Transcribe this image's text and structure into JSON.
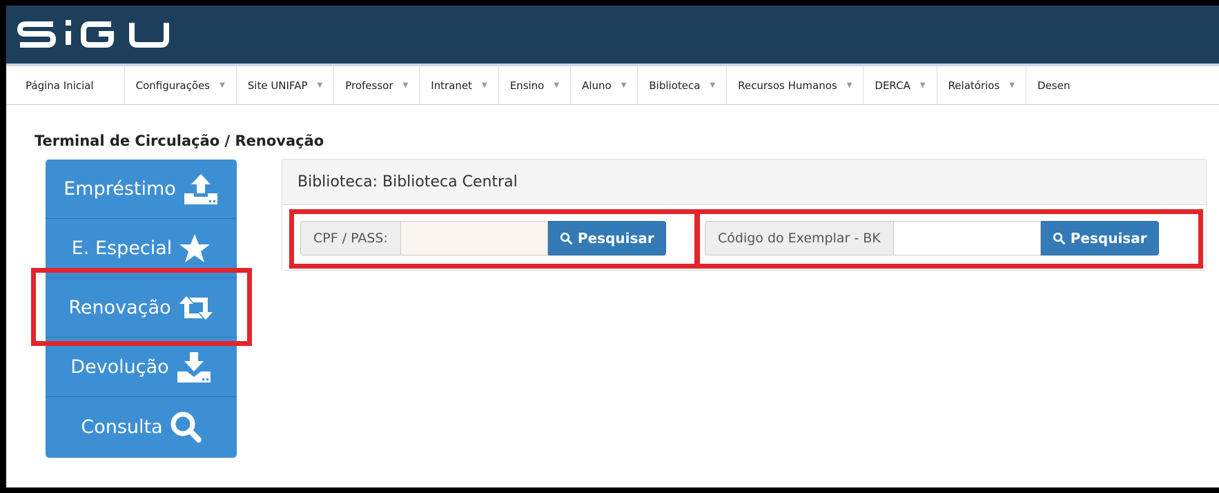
{
  "header": {
    "logo_text": "SIGU",
    "color": "#1e3f5c"
  },
  "nav": {
    "items": [
      {
        "label": "Página Inicial",
        "has_dropdown": false
      },
      {
        "label": "Configurações",
        "has_dropdown": true
      },
      {
        "label": "Site UNIFAP",
        "has_dropdown": true
      },
      {
        "label": "Professor",
        "has_dropdown": true
      },
      {
        "label": "Intranet",
        "has_dropdown": true
      },
      {
        "label": "Ensino",
        "has_dropdown": true
      },
      {
        "label": "Aluno",
        "has_dropdown": true
      },
      {
        "label": "Biblioteca",
        "has_dropdown": true
      },
      {
        "label": "Recursos Humanos",
        "has_dropdown": true
      },
      {
        "label": "DERCA",
        "has_dropdown": true
      },
      {
        "label": "Relatórios",
        "has_dropdown": true
      },
      {
        "label": "Desen",
        "has_dropdown": false
      }
    ],
    "caret": "▼"
  },
  "page": {
    "title": "Terminal de Circulação / Renovação"
  },
  "side_menu": {
    "color": "#3d8fd4",
    "items": [
      {
        "label": "Empréstimo",
        "icon": "upload-icon"
      },
      {
        "label": "E. Especial",
        "icon": "star-icon"
      },
      {
        "label": "Renovação",
        "icon": "retweet-icon"
      },
      {
        "label": "Devolução",
        "icon": "download-icon"
      },
      {
        "label": "Consulta",
        "icon": "search-icon"
      }
    ]
  },
  "panel": {
    "heading": "Biblioteca: Biblioteca Central",
    "cpf_search": {
      "label": "CPF / PASS:",
      "value": "",
      "button_label": "Pesquisar"
    },
    "exemplar_search": {
      "label": "Código do Exemplar - BK",
      "value": "",
      "button_label": "Pesquisar"
    }
  },
  "highlight_color": "#e3242b"
}
